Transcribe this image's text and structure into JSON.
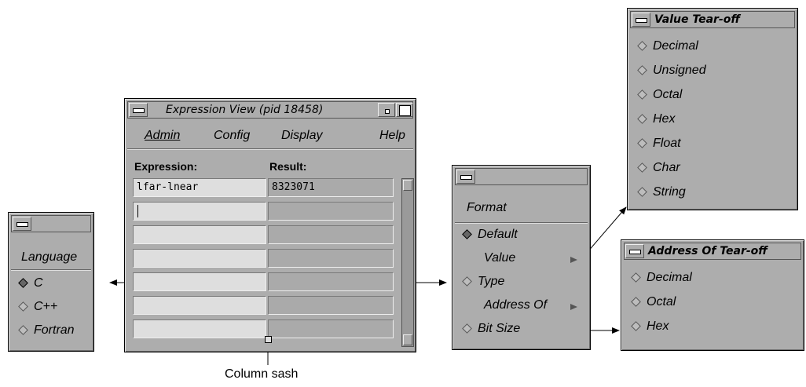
{
  "expression_view": {
    "title": "Expression View (pid 18458)",
    "menus": [
      "Admin",
      "Config",
      "Display",
      "Help"
    ],
    "columns": {
      "expression": "Expression:",
      "result": "Result:"
    },
    "rows": [
      {
        "expression": "lfar-lnear",
        "result": "8323071"
      },
      {
        "expression": "",
        "result": ""
      },
      {
        "expression": "",
        "result": ""
      },
      {
        "expression": "",
        "result": ""
      },
      {
        "expression": "",
        "result": ""
      },
      {
        "expression": "",
        "result": ""
      },
      {
        "expression": "",
        "result": ""
      }
    ]
  },
  "language_menu": {
    "title": "Language",
    "items": [
      {
        "label": "C",
        "selected": true
      },
      {
        "label": "C++",
        "selected": false
      },
      {
        "label": "Fortran",
        "selected": false
      }
    ]
  },
  "format_menu": {
    "title": "Format",
    "items": [
      {
        "label": "Default",
        "type": "radio",
        "selected": true
      },
      {
        "label": "Value",
        "type": "cascade"
      },
      {
        "label": "Type",
        "type": "radio",
        "selected": false
      },
      {
        "label": "Address Of",
        "type": "cascade"
      },
      {
        "label": "Bit Size",
        "type": "radio",
        "selected": false
      }
    ]
  },
  "value_tearoff": {
    "title": "Value Tear-off",
    "items": [
      "Decimal",
      "Unsigned",
      "Octal",
      "Hex",
      "Float",
      "Char",
      "String"
    ]
  },
  "address_tearoff": {
    "title": "Address Of Tear-off",
    "items": [
      "Decimal",
      "Octal",
      "Hex"
    ]
  },
  "callout": {
    "column_sash": "Column sash"
  }
}
